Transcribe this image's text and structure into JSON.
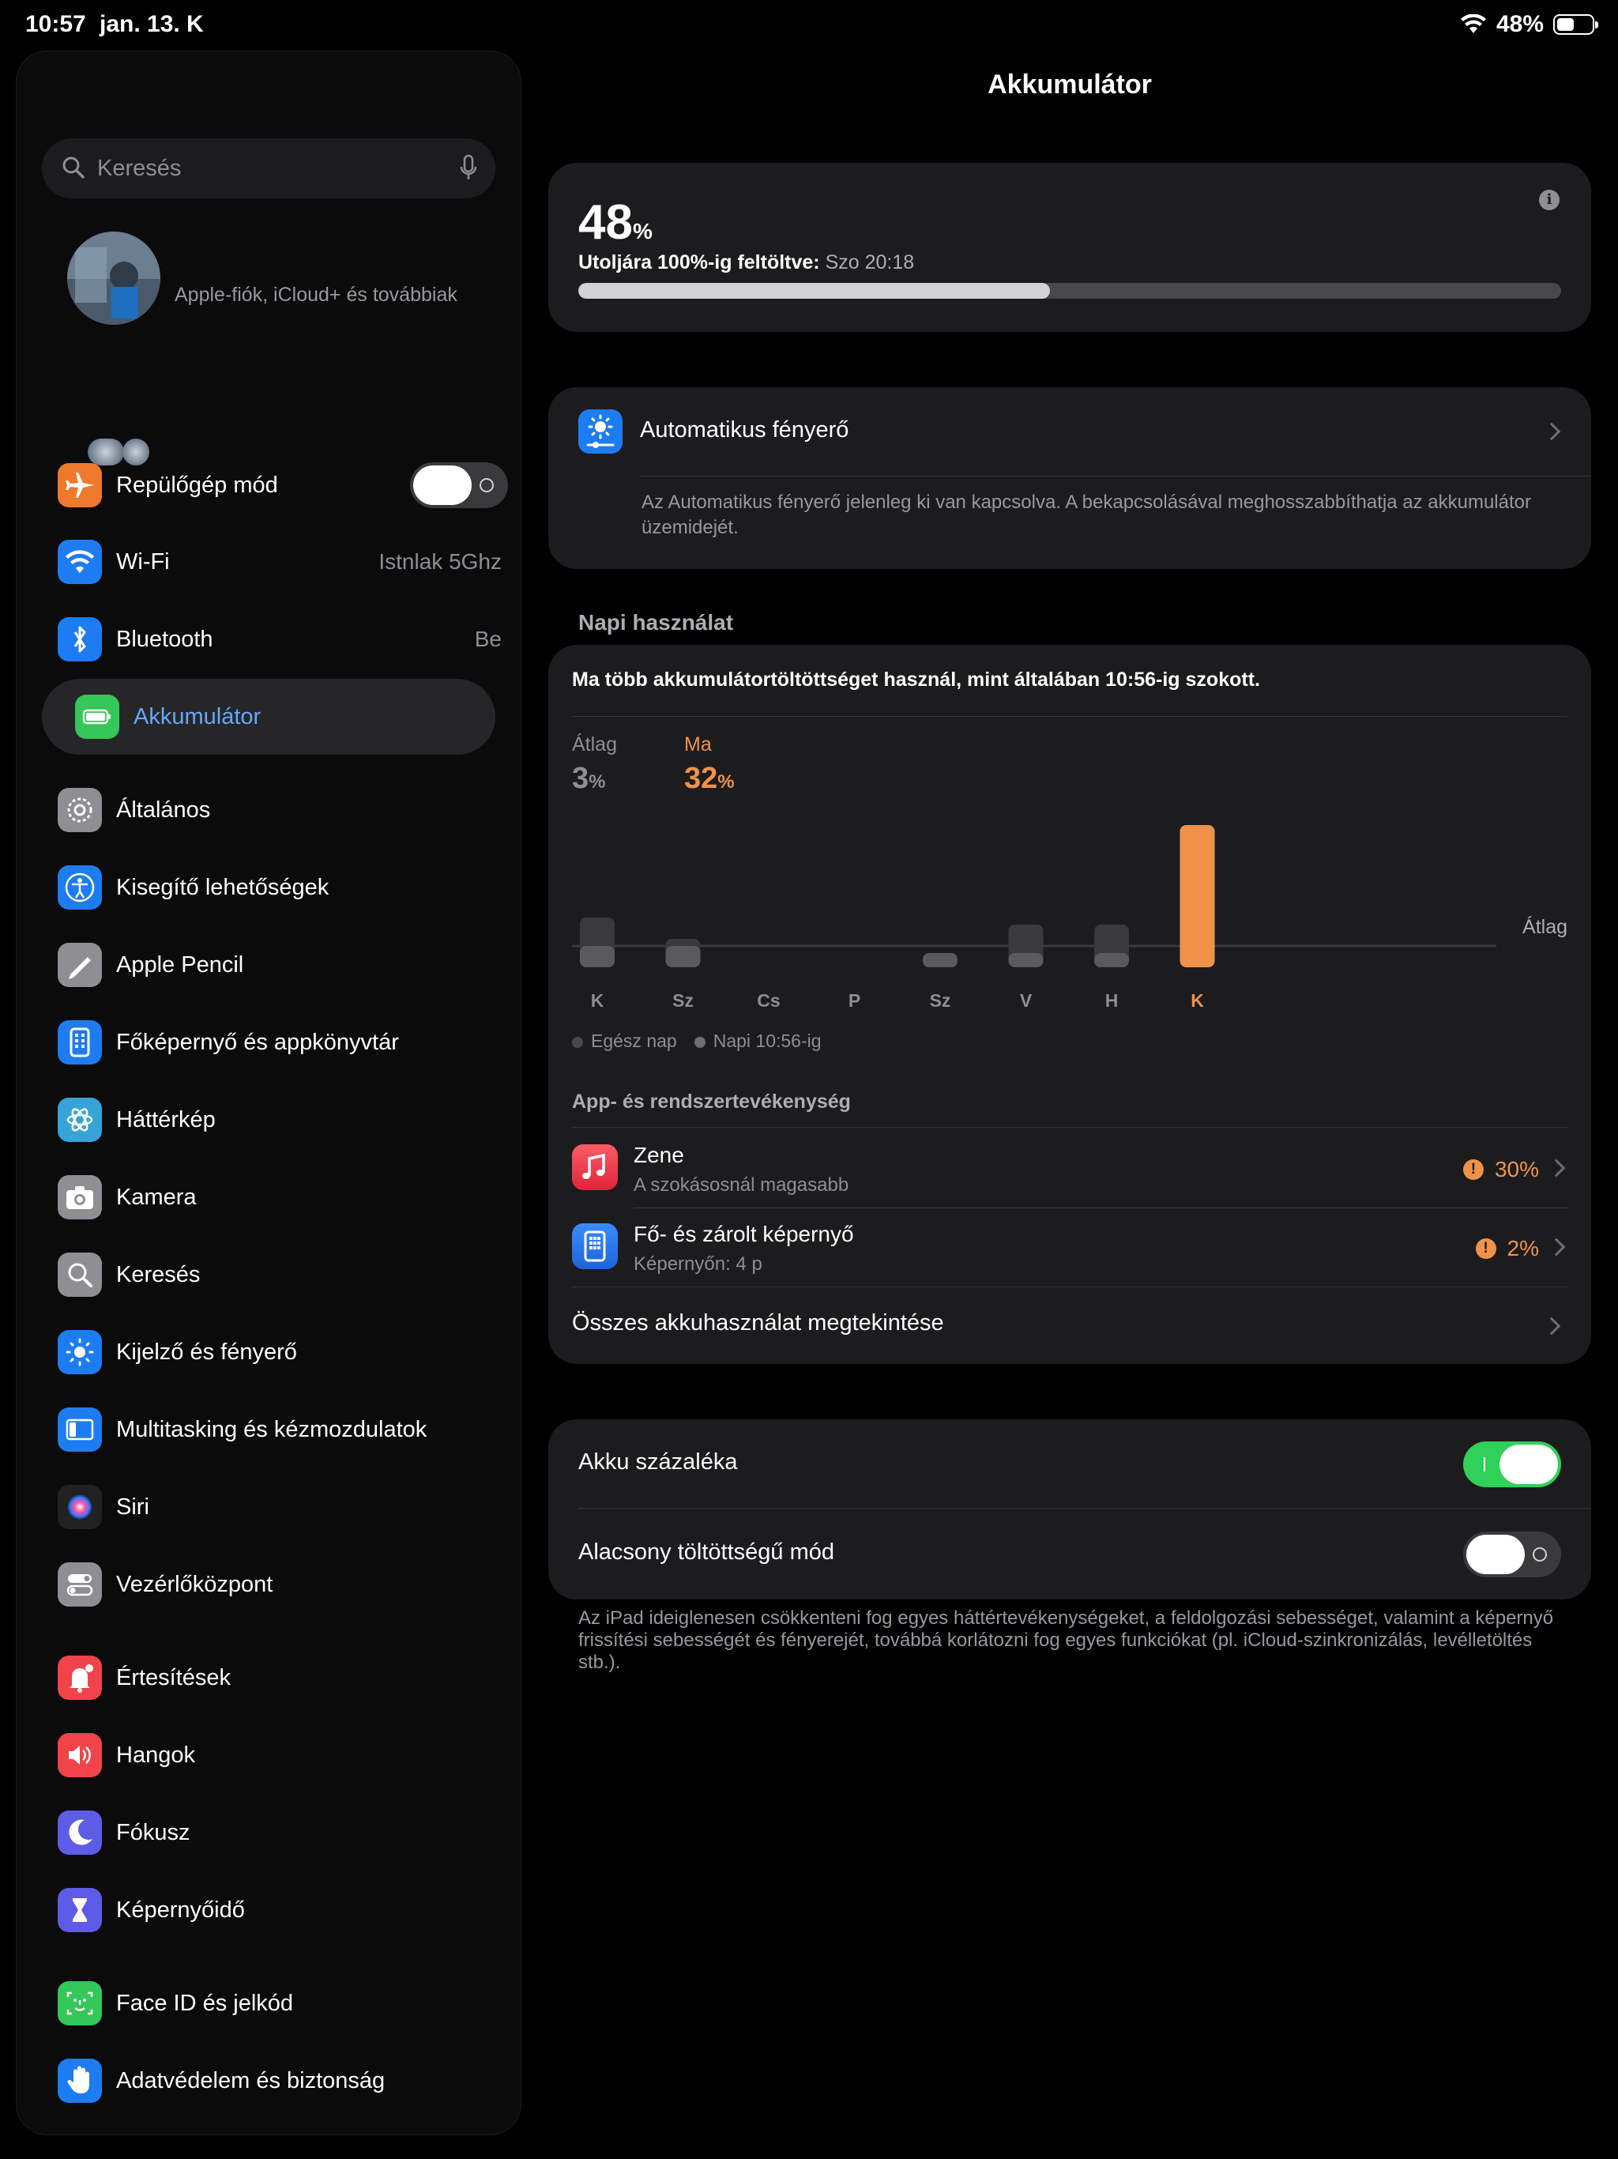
{
  "status_bar": {
    "time": "10:57",
    "date": "jan. 13. K",
    "battery_percent": "48%",
    "battery_level": 0.48
  },
  "sidebar": {
    "search_placeholder": "Keresés",
    "profile_subtitle": "Apple-fiók, iCloud+ és továbbiak",
    "items": [
      {
        "label": "Repülőgép mód",
        "icon": "airplane-icon",
        "color": "#f0782a",
        "toggle": "off"
      },
      {
        "label": "Wi-Fi",
        "icon": "wifi-icon",
        "color": "#1e7cf2",
        "value": "Istnlak 5Ghz"
      },
      {
        "label": "Bluetooth",
        "icon": "bluetooth-icon",
        "color": "#1e7cf2",
        "value": "Be"
      },
      {
        "label": "Akkumulátor",
        "icon": "battery-icon",
        "color": "#34c759",
        "active": true
      },
      {
        "label": "Általános",
        "icon": "gear-icon",
        "color": "#8e8e93"
      },
      {
        "label": "Kisegítő lehetőségek",
        "icon": "accessibility-icon",
        "color": "#1e7cf2"
      },
      {
        "label": "Apple Pencil",
        "icon": "pencil-icon",
        "color": "#8e8e93"
      },
      {
        "label": "Főképernyő és appkönyvtár",
        "icon": "home-screen-icon",
        "color": "#1e7cf2"
      },
      {
        "label": "Háttérkép",
        "icon": "wallpaper-icon",
        "color": "#36a4d8"
      },
      {
        "label": "Kamera",
        "icon": "camera-icon",
        "color": "#8e8e93"
      },
      {
        "label": "Keresés",
        "icon": "search-icon",
        "color": "#8e8e93"
      },
      {
        "label": "Kijelző és fényerő",
        "icon": "brightness-icon",
        "color": "#1e7cf2"
      },
      {
        "label": "Multitasking és kézmozdulatok",
        "icon": "multitasking-icon",
        "color": "#1e7cf2"
      },
      {
        "label": "Siri",
        "icon": "siri-icon",
        "color": "#222"
      },
      {
        "label": "Vezérlőközpont",
        "icon": "control-center-icon",
        "color": "#8e8e93"
      },
      {
        "label": "Értesítések",
        "icon": "bell-icon",
        "color": "#f0434a"
      },
      {
        "label": "Hangok",
        "icon": "speaker-icon",
        "color": "#f0434a"
      },
      {
        "label": "Fókusz",
        "icon": "moon-icon",
        "color": "#5e5ce6"
      },
      {
        "label": "Képernyőidő",
        "icon": "hourglass-icon",
        "color": "#5e5ce6"
      },
      {
        "label": "Face ID és jelkód",
        "icon": "face-id-icon",
        "color": "#34c759"
      },
      {
        "label": "Adatvédelem és biztonság",
        "icon": "hand-icon",
        "color": "#1e7cf2"
      }
    ]
  },
  "main": {
    "title": "Akkumulátor",
    "battery": {
      "percent": "48",
      "percent_sign": "%",
      "last_charged_label": "Utoljára 100%-ig feltöltve:",
      "last_charged_value": "Szo 20:18",
      "level": 0.48
    },
    "auto_brightness": {
      "label": "Automatikus fényerő",
      "note": "Az Automatikus fényerő jelenleg ki van kapcsolva. A bekapcsolásával meghosszabbíthatja az akkumulátor üzemidejét."
    },
    "daily_usage": {
      "section_title": "Napi használat",
      "message": "Ma több akkumulátortöltöttséget használ, mint általában 10:56-ig szokott.",
      "average_label": "Átlag",
      "average_value": "3",
      "today_label": "Ma",
      "today_value": "32",
      "pct": "%",
      "avg_line_label": "Átlag",
      "legend": [
        "Egész nap",
        "Napi 10:56-ig"
      ],
      "activity_title": "App- és rendszertevékenység",
      "apps": [
        {
          "name": "Zene",
          "subtitle": "A szokásosnál magasabb",
          "percent": "30%",
          "icon": "music-icon",
          "color": "#f0434a"
        },
        {
          "name": "Fő- és zárolt képernyő",
          "subtitle": "Képernyőn: 4 p",
          "percent": "2%",
          "icon": "home-screen-icon",
          "color": "#1e7cf2"
        }
      ],
      "view_all": "Összes akkuhasználat megtekintése"
    },
    "settings": {
      "battery_percentage": "Akku százaléka",
      "battery_percentage_on": true,
      "low_power_mode": "Alacsony töltöttségű mód",
      "low_power_mode_on": false,
      "low_power_note": "Az iPad ideiglenesen csökkenteni fog egyes háttértevékenységeket, a feldolgozási sebességet, valamint a képernyő frissítési sebességét és fényerejét, továbbá korlátozni fog egyes funkciókat (pl. iCloud-szinkronizálás, levélletöltés stb.)."
    }
  },
  "chart_data": {
    "type": "bar",
    "categories": [
      "K",
      "Sz",
      "Cs",
      "P",
      "Sz",
      "V",
      "H",
      "K"
    ],
    "series": [
      {
        "name": "Egész nap",
        "values": [
          7,
          4,
          0,
          0,
          2,
          6,
          6,
          20
        ]
      },
      {
        "name": "Napi 10:56-ig",
        "values": [
          3,
          3,
          0,
          0,
          2,
          2,
          2,
          20
        ]
      }
    ],
    "highlight_index": 7,
    "highlight_color": "#f0924a",
    "bar_color": "#3a3a3c",
    "bar_color_partial": "#5a5a5e",
    "average_line": 3,
    "average_line_label": "Átlag",
    "ylim": [
      0,
      20
    ]
  }
}
